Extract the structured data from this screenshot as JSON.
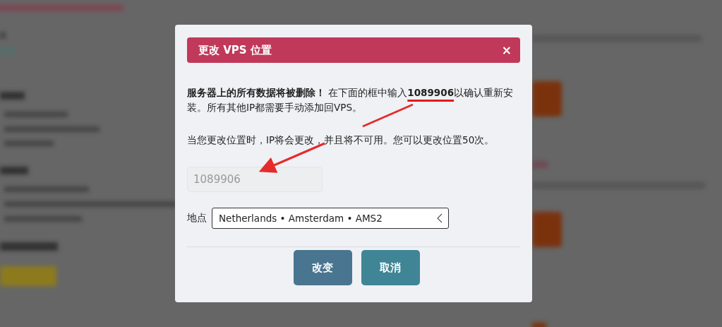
{
  "dialog": {
    "title": "更改 VPS 位置",
    "close": "×",
    "warning": "**服务器上的所有数据将被删除！** 在下面的框中输入**1089906**以确认重新安装。所有其他IP都需要手动添加回VPS。",
    "note": "当您更改位置时，IP将会更改，并且将不可用。您可以更改位置50次。",
    "confirm_field": {
      "placeholder": "1089906"
    },
    "location": {
      "label": "地点",
      "value": "Netherlands • Amsterdam • AMS2"
    },
    "buttons": [
      {
        "label": "改变",
        "kind": "primary"
      },
      {
        "label": "取消",
        "kind": "secondary"
      }
    ]
  }
}
